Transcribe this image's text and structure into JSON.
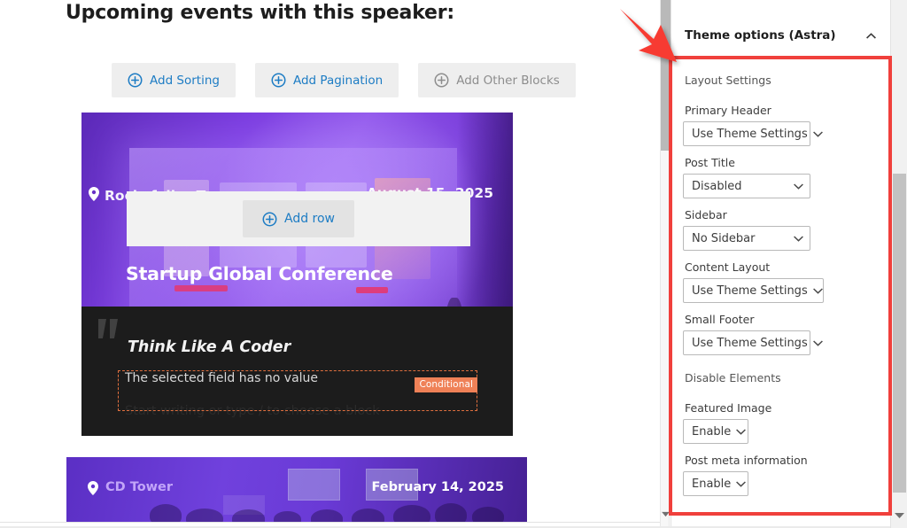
{
  "editor": {
    "page_title": "Upcoming events with this speaker:",
    "block_buttons": [
      {
        "label": "Add Sorting",
        "icon": "plus-circle-icon",
        "style": "blue"
      },
      {
        "label": "Add Pagination",
        "icon": "plus-circle-icon",
        "style": "blue"
      },
      {
        "label": "Add Other Blocks",
        "icon": "plus-circle-icon",
        "style": "gray"
      }
    ],
    "add_row": {
      "label": "Add row",
      "icon": "plus-circle-icon"
    },
    "event_cards": [
      {
        "location": "Rockefeller Tower",
        "date": "August 15, 2025",
        "title": "Startup Global Conference",
        "location_icon": "map-pin-icon"
      },
      {
        "location": "CD Tower",
        "date": "February 14, 2025",
        "location_icon": "map-pin-icon"
      }
    ],
    "dark_panel": {
      "quote_title": "Think Like A Coder",
      "no_value_text": "The selected field has no value",
      "conditional_badge": "Conditional",
      "block_placeholder": "Start writing or type / to choose a block"
    }
  },
  "sidebar": {
    "header": {
      "title": "Theme options (Astra)",
      "toggle_icon": "chevron-up-icon"
    },
    "sections": [
      {
        "label": "Layout Settings",
        "fields": [
          {
            "label": "Primary Header",
            "value": "Use Theme Settings"
          },
          {
            "label": "Post Title",
            "value": "Disabled"
          },
          {
            "label": "Sidebar",
            "value": "No Sidebar"
          },
          {
            "label": "Content Layout",
            "value": "Use Theme Settings"
          },
          {
            "label": "Small Footer",
            "value": "Use Theme Settings"
          }
        ]
      },
      {
        "label": "Disable Elements",
        "fields": [
          {
            "label": "Featured Image",
            "value": "Enable"
          },
          {
            "label": "Post meta information",
            "value": "Enable"
          }
        ]
      }
    ]
  },
  "annotation": {
    "highlight_color": "#f0403c",
    "arrow_color": "#f73b33",
    "arrow_icon": "arrow-down-right-icon"
  },
  "colors": {
    "accent_blue": "#1d7cc4",
    "card_purple": "#6a2ecb",
    "dark_panel": "#1c1c1c",
    "conditional_orange": "#ef8157"
  }
}
